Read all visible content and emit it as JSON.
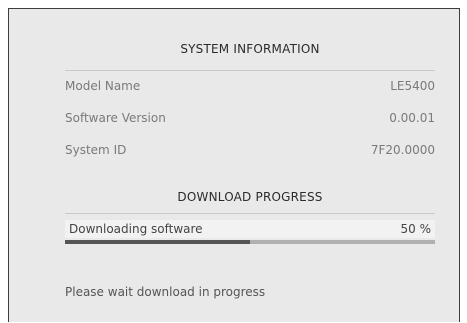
{
  "system_info": {
    "title": "SYSTEM INFORMATION",
    "rows": [
      {
        "label": "Model Name",
        "value": "LE5400"
      },
      {
        "label": "Software Version",
        "value": "0.00.01"
      },
      {
        "label": "System ID",
        "value": "7F20.0000"
      }
    ]
  },
  "download": {
    "title": "DOWNLOAD PROGRESS",
    "label": "Downloading software",
    "percent_text": "50 %",
    "progress_fraction": 0.5,
    "status_message": "Please wait download in progress"
  },
  "colors": {
    "panel_background": "#e9e9e9",
    "progress_fill": "#555555",
    "progress_track": "#b0b0b0"
  }
}
